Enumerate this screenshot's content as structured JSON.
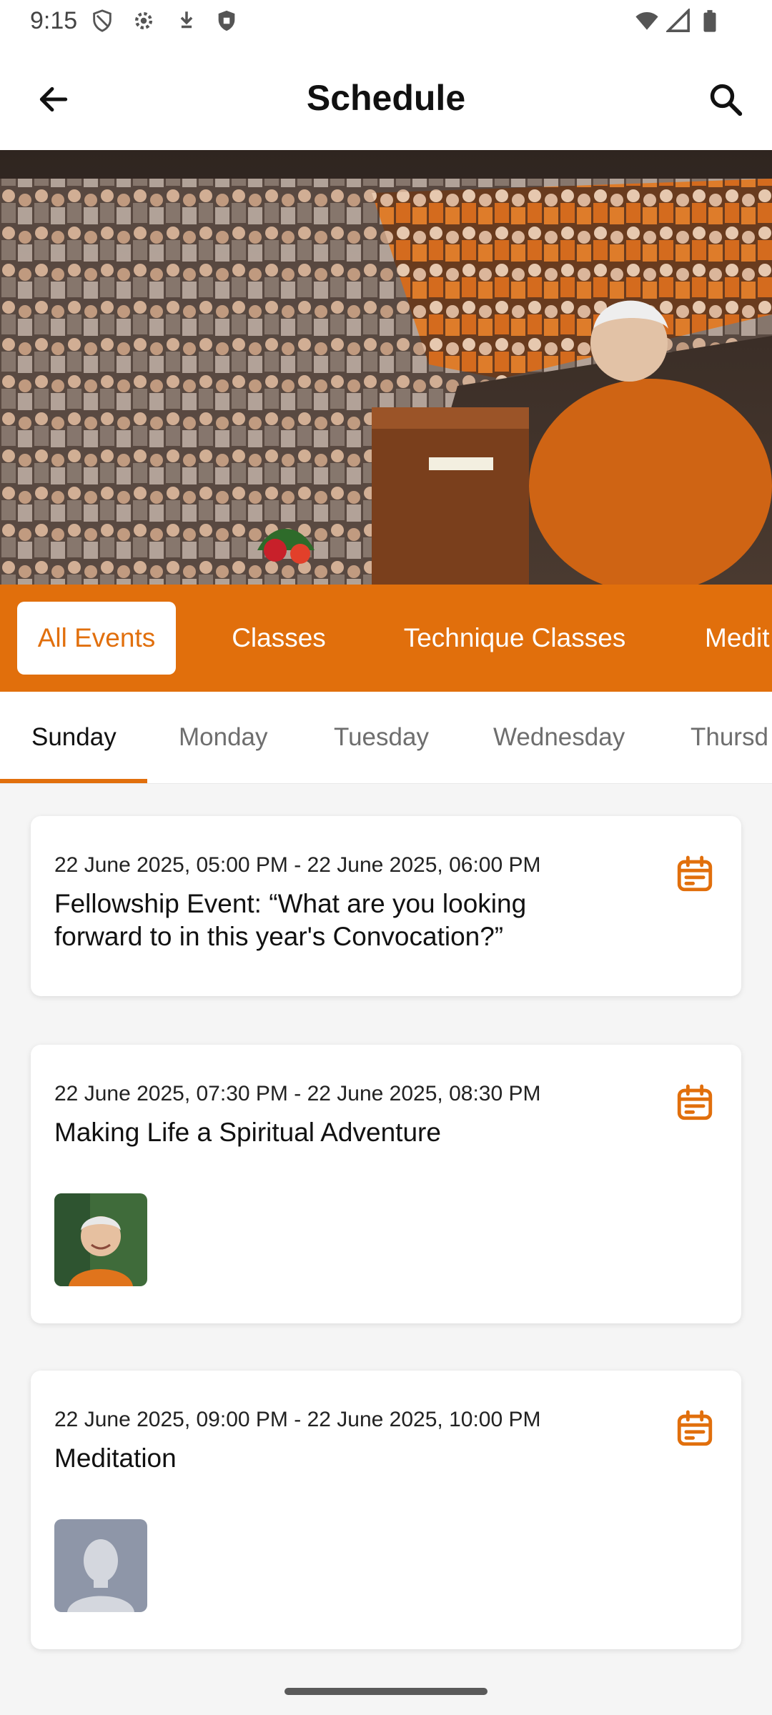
{
  "status_bar": {
    "time": "9:15"
  },
  "app_bar": {
    "title": "Schedule"
  },
  "categories": [
    {
      "label": "All Events",
      "active": true
    },
    {
      "label": "Classes",
      "active": false
    },
    {
      "label": "Technique Classes",
      "active": false
    },
    {
      "label": "Medit",
      "active": false
    }
  ],
  "days": [
    {
      "label": "Sunday",
      "active": true
    },
    {
      "label": "Monday",
      "active": false
    },
    {
      "label": "Tuesday",
      "active": false
    },
    {
      "label": "Wednesday",
      "active": false
    },
    {
      "label": "Thursd",
      "active": false
    }
  ],
  "events": [
    {
      "datetime": "22 June 2025, 05:00 PM - 22 June 2025, 06:00 PM",
      "title": "Fellowship Event: “What are you looking forward to in this year's Convocation?”"
    },
    {
      "datetime": "22 June 2025, 07:30 PM - 22 June 2025, 08:30 PM",
      "title": "Making Life a Spiritual Adventure"
    },
    {
      "datetime": "22 June 2025, 09:00 PM - 22 June 2025, 10:00 PM",
      "title": "Meditation"
    }
  ],
  "colors": {
    "accent": "#e16f0c"
  }
}
